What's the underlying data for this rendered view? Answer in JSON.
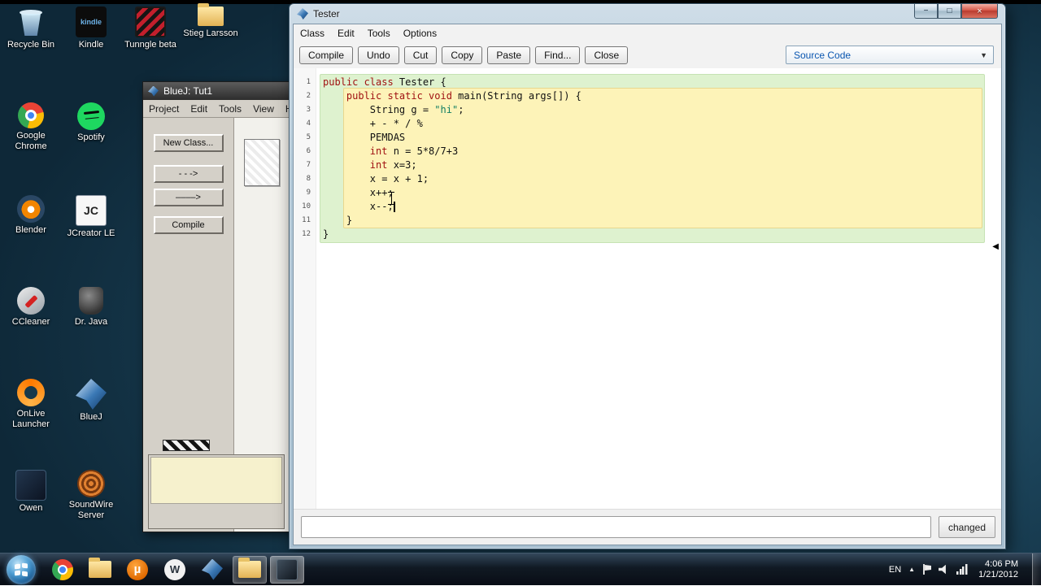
{
  "colors": {
    "scope-class-bg": "#def2cf",
    "scope-method-bg": "#fdf3b8",
    "keyword": "#a01212",
    "string": "#0f7d62",
    "combo-text": "#0a56b0"
  },
  "icons": {
    "minimize": "−",
    "maximize": "□",
    "close": "×",
    "combo_arrow": "▼",
    "scroll_marker": "◀",
    "tray_expand": "▲"
  },
  "desktop": {
    "icons": [
      {
        "id": "recycle-bin",
        "label": "Recycle Bin",
        "col": 0,
        "row": 0
      },
      {
        "id": "kindle",
        "label": "Kindle",
        "col": 1,
        "row": 0,
        "glyph": "kindle"
      },
      {
        "id": "tunngle",
        "label": "Tunngle beta",
        "col": 2,
        "row": 0
      },
      {
        "id": "stieg-larsson",
        "label": "Stieg Larsson",
        "col": 3,
        "row": 0
      },
      {
        "id": "google-chrome",
        "label": "Google Chrome",
        "col": 0,
        "row": 1
      },
      {
        "id": "spotify",
        "label": "Spotify",
        "col": 1,
        "row": 1
      },
      {
        "id": "blender",
        "label": "Blender",
        "col": 0,
        "row": 2
      },
      {
        "id": "jcreator-le",
        "label": "JCreator LE",
        "col": 1,
        "row": 2,
        "glyph": "JC"
      },
      {
        "id": "ccleaner",
        "label": "CCleaner",
        "col": 0,
        "row": 3
      },
      {
        "id": "dr-java",
        "label": "Dr. Java",
        "col": 1,
        "row": 3
      },
      {
        "id": "onlive-launcher",
        "label": "OnLive Launcher",
        "col": 0,
        "row": 4
      },
      {
        "id": "bluej",
        "label": "BlueJ",
        "col": 1,
        "row": 4
      },
      {
        "id": "owen",
        "label": "Owen",
        "col": 0,
        "row": 5
      },
      {
        "id": "soundwire-server",
        "label": "SoundWire Server",
        "col": 1,
        "row": 5
      }
    ]
  },
  "bluej_window": {
    "title": "BlueJ: Tut1",
    "menu": [
      "Project",
      "Edit",
      "Tools",
      "View",
      "Help"
    ],
    "buttons": [
      "New Class...",
      "- - ->",
      "––––>",
      "Compile"
    ]
  },
  "tester_window": {
    "title": "Tester",
    "menu": [
      "Class",
      "Edit",
      "Tools",
      "Options"
    ],
    "toolbar_buttons": [
      "Compile",
      "Undo",
      "Cut",
      "Copy",
      "Paste",
      "Find...",
      "Close"
    ],
    "view_selector": "Source Code",
    "status_value": "",
    "status_badge": "changed",
    "code_lines": [
      [
        {
          "c": "k",
          "t": "public class"
        },
        {
          "c": "p",
          "t": " Tester {"
        }
      ],
      [
        {
          "c": "p",
          "t": "    "
        },
        {
          "c": "k",
          "t": "public static void"
        },
        {
          "c": "p",
          "t": " main(String args[]) {"
        }
      ],
      [
        {
          "c": "p",
          "t": "        String g = "
        },
        {
          "c": "s",
          "t": "\"hi\""
        },
        {
          "c": "p",
          "t": ";"
        }
      ],
      [
        {
          "c": "p",
          "t": "        + - * / %"
        }
      ],
      [
        {
          "c": "p",
          "t": "        PEMDAS"
        }
      ],
      [
        {
          "c": "p",
          "t": "        "
        },
        {
          "c": "k",
          "t": "int"
        },
        {
          "c": "p",
          "t": " n = 5*8/7+3"
        }
      ],
      [
        {
          "c": "p",
          "t": "        "
        },
        {
          "c": "k",
          "t": "int"
        },
        {
          "c": "p",
          "t": " x=3;"
        }
      ],
      [
        {
          "c": "p",
          "t": "        x = x + 1;"
        }
      ],
      [
        {
          "c": "p",
          "t": "        x++;"
        }
      ],
      [
        {
          "c": "p",
          "t": "        x--;"
        }
      ],
      [
        {
          "c": "p",
          "t": "    }"
        }
      ],
      [
        {
          "c": "p",
          "t": "}"
        }
      ]
    ]
  },
  "taskbar": {
    "items": [
      {
        "id": "chrome",
        "state": "pinned"
      },
      {
        "id": "explorer",
        "state": "pinned"
      },
      {
        "id": "utorrent",
        "state": "pinned",
        "glyph": "µ"
      },
      {
        "id": "wapp",
        "state": "pinned",
        "glyph": "W"
      },
      {
        "id": "bluej",
        "state": "pinned"
      },
      {
        "id": "open-folder",
        "state": "open"
      },
      {
        "id": "active-app",
        "state": "active"
      }
    ],
    "tray": {
      "language": "EN",
      "time": "4:06 PM",
      "date": "1/21/2012"
    }
  }
}
